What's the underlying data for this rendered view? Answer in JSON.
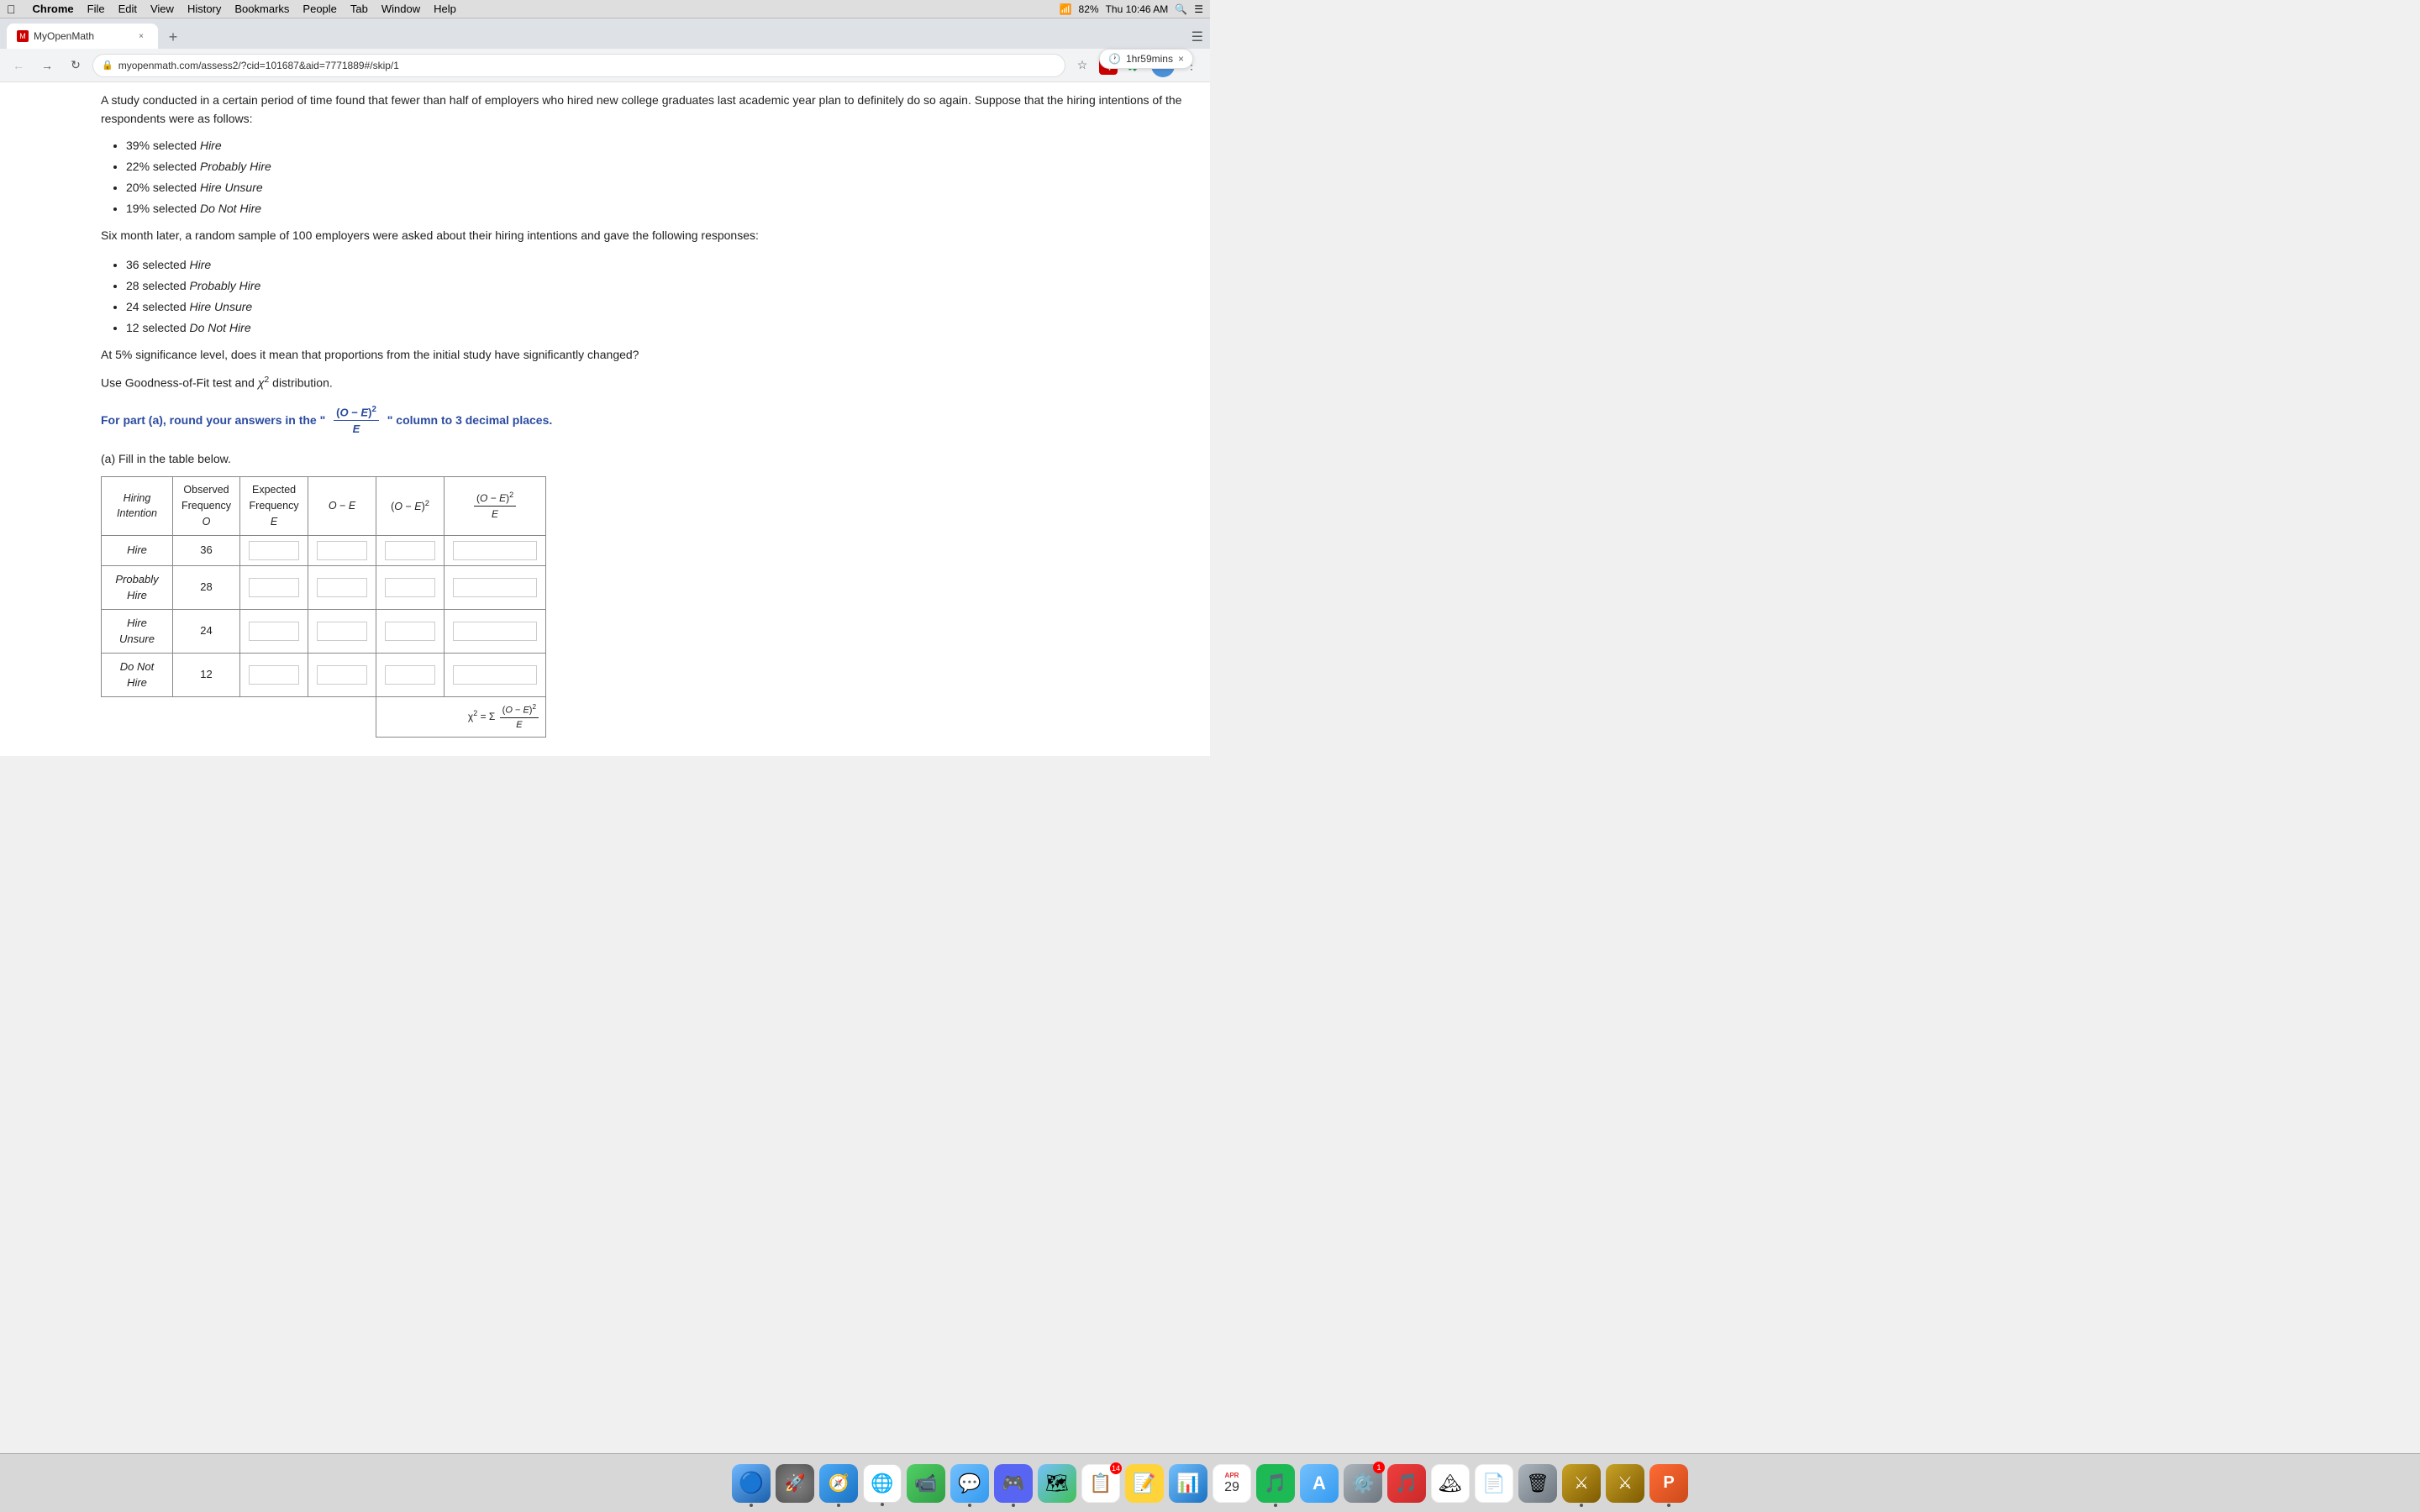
{
  "menubar": {
    "apple": "⌘",
    "chrome": "Chrome",
    "file": "File",
    "edit": "Edit",
    "view": "View",
    "history": "History",
    "bookmarks": "Bookmarks",
    "people": "People",
    "tab": "Tab",
    "window": "Window",
    "help": "Help",
    "battery": "82%",
    "time": "Thu 10:46 AM"
  },
  "tab": {
    "title": "MyOpenMath",
    "favicon": "M",
    "close_label": "×"
  },
  "addressbar": {
    "url": "myopenmath.com/assess2/?cid=101687&aid=7771889#/skip/1"
  },
  "timer": {
    "label": "1hr59mins",
    "close": "×"
  },
  "content": {
    "intro_text": "A study conducted in a certain period of time found that fewer than half of employers who hired new college graduates last academic year plan to definitely do so again. Suppose that the hiring intentions of the respondents were as follows:",
    "initial_bullets": [
      {
        "pct": "39%",
        "label": "selected ",
        "item": "Hire"
      },
      {
        "pct": "22%",
        "label": "selected ",
        "item": "Probably Hire"
      },
      {
        "pct": "20%",
        "label": "selected ",
        "item": "Hire Unsure"
      },
      {
        "pct": "19%",
        "label": "selected ",
        "item": "Do Not Hire"
      }
    ],
    "followup_text": "Six month later, a random sample of 100 employers were asked about their hiring intentions and gave the following responses:",
    "sample_bullets": [
      {
        "count": "36",
        "label": "selected ",
        "item": "Hire"
      },
      {
        "count": "28",
        "label": "selected ",
        "item": "Probably Hire"
      },
      {
        "count": "24",
        "label": "selected ",
        "item": "Hire Unsure"
      },
      {
        "count": "12",
        "label": "selected ",
        "item": "Do Not Hire"
      }
    ],
    "question_text": "At 5% significance level, does it mean that proportions from the initial study have significantly changed?",
    "method_text": "Use Goodness-of-Fit test and χ² distribution.",
    "formula_note_prefix": "For part (a), round your answers in the \"",
    "formula_note_suffix": "\" column to 3 decimal places.",
    "part_a_label": "(a) Fill in the table below.",
    "table_headers": {
      "col1": "Hiring Intention",
      "col2_top": "Observed",
      "col2_mid": "Frequency",
      "col2_bot": "O",
      "col3_top": "Expected",
      "col3_mid": "Frequency",
      "col3_bot": "E",
      "col4": "O − E",
      "col5": "(O − E)²",
      "col6_top": "(O − E)²",
      "col6_bot": "E"
    },
    "table_rows": [
      {
        "intention": "Hire",
        "observed": "36"
      },
      {
        "intention": "Probably Hire",
        "observed": "28"
      },
      {
        "intention": "Hire Unsure",
        "observed": "24"
      },
      {
        "intention": "Do Not Hire",
        "observed": "12"
      }
    ]
  },
  "dock": {
    "items": [
      {
        "name": "Finder",
        "emoji": "🔵",
        "color": "dock-finder"
      },
      {
        "name": "Launchpad",
        "emoji": "🚀",
        "color": "dock-launchpad"
      },
      {
        "name": "Safari",
        "emoji": "🧭",
        "color": "dock-safari"
      },
      {
        "name": "Chrome",
        "emoji": "⚙",
        "color": "dock-chrome"
      },
      {
        "name": "FaceTime",
        "emoji": "📹",
        "color": "dock-facetime"
      },
      {
        "name": "Messages",
        "emoji": "💬",
        "color": "dock-messages"
      },
      {
        "name": "Discord",
        "emoji": "🎮",
        "color": "dock-discord"
      },
      {
        "name": "Maps",
        "emoji": "🗺",
        "color": "dock-maps"
      },
      {
        "name": "Reminders",
        "emoji": "📋",
        "color": "dock-reminders",
        "badge": "14"
      },
      {
        "name": "Notes",
        "emoji": "📝",
        "color": "dock-notes"
      },
      {
        "name": "Keynote",
        "emoji": "📊",
        "color": "dock-keynote"
      },
      {
        "name": "Clock",
        "emoji": "🕐",
        "color": "dock-clock",
        "date_top": "APR",
        "date_bot": "29"
      },
      {
        "name": "Spotify",
        "emoji": "🎵",
        "color": "dock-spotify"
      },
      {
        "name": "AppStore",
        "emoji": "🅐",
        "color": "dock-appstore"
      },
      {
        "name": "SystemPrefs",
        "emoji": "⚙",
        "color": "dock-sysprefs",
        "badge": "1"
      },
      {
        "name": "Music",
        "emoji": "🎵",
        "color": "dock-music"
      },
      {
        "name": "Photos",
        "emoji": "🖼",
        "color": "dock-photos"
      },
      {
        "name": "TextEdit",
        "emoji": "📄",
        "color": "dock-textedit"
      },
      {
        "name": "Trash",
        "emoji": "🗑",
        "color": "dock-trash"
      },
      {
        "name": "LeagueClient1",
        "emoji": "⚔",
        "color": "dock-league1"
      },
      {
        "name": "LeagueClient2",
        "emoji": "⚔",
        "color": "dock-league2"
      },
      {
        "name": "PowerPoint",
        "emoji": "P",
        "color": "dock-powerpoint"
      }
    ]
  }
}
